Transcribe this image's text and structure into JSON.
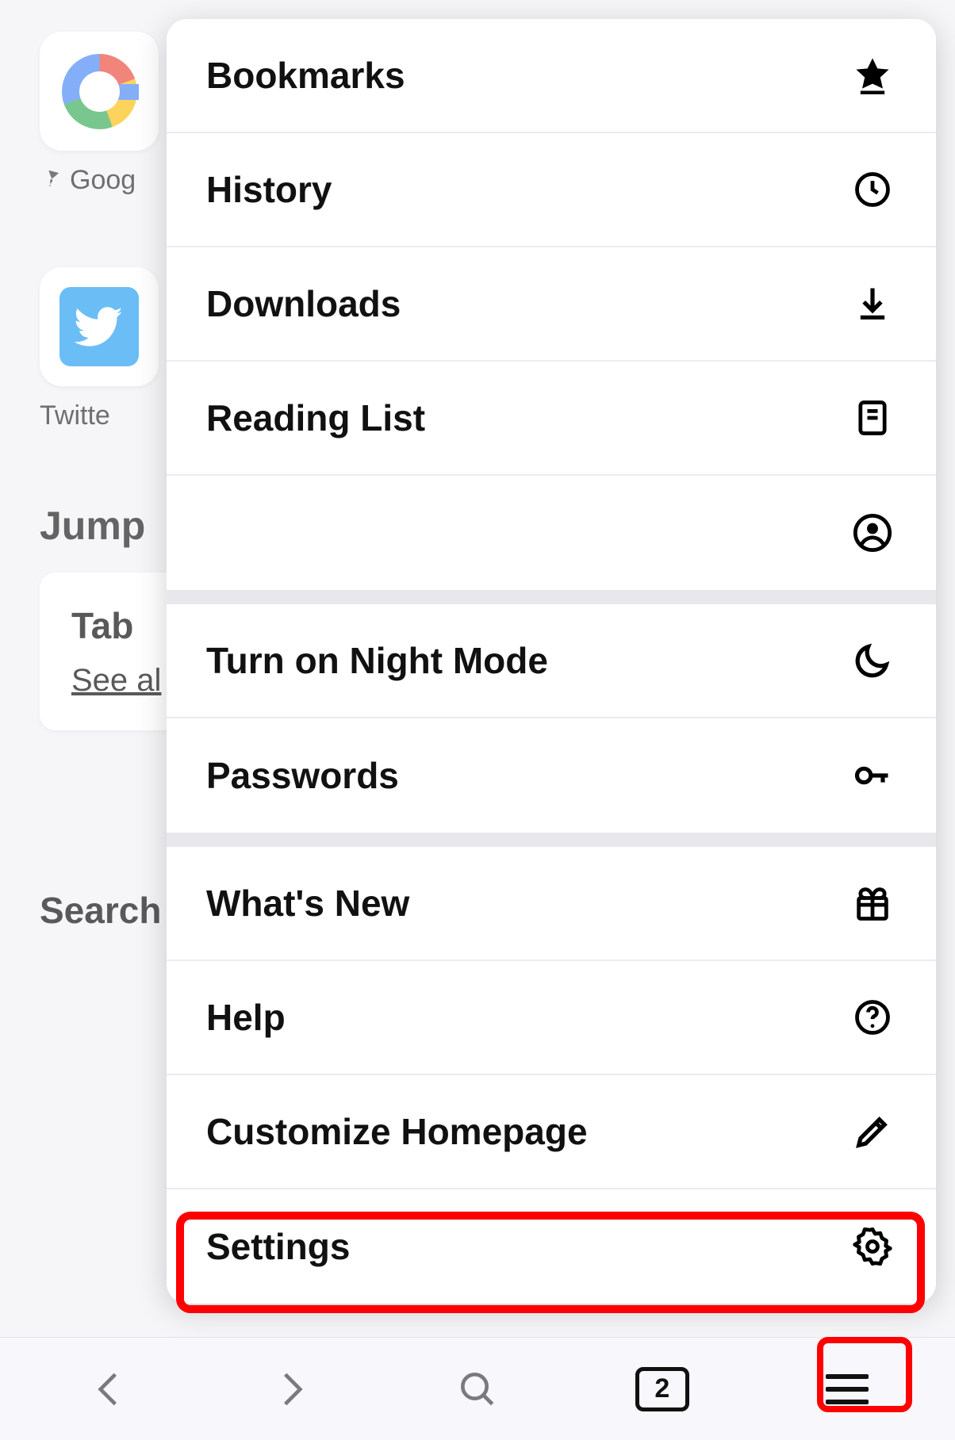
{
  "home": {
    "google_label": "Goog",
    "twitter_label": "Twitte",
    "jump_heading": "Jump",
    "tab_title": "Tab",
    "see_all": "See al",
    "search_label": "Search"
  },
  "menu": {
    "group1": {
      "bookmarks": "Bookmarks",
      "history": "History",
      "downloads": "Downloads",
      "reading_list": "Reading List",
      "account": ""
    },
    "group2": {
      "night_mode": "Turn on Night Mode",
      "passwords": "Passwords"
    },
    "group3": {
      "whats_new": "What's New",
      "help": "Help",
      "customize": "Customize Homepage",
      "settings": "Settings"
    }
  },
  "toolbar": {
    "tab_count": "2"
  }
}
